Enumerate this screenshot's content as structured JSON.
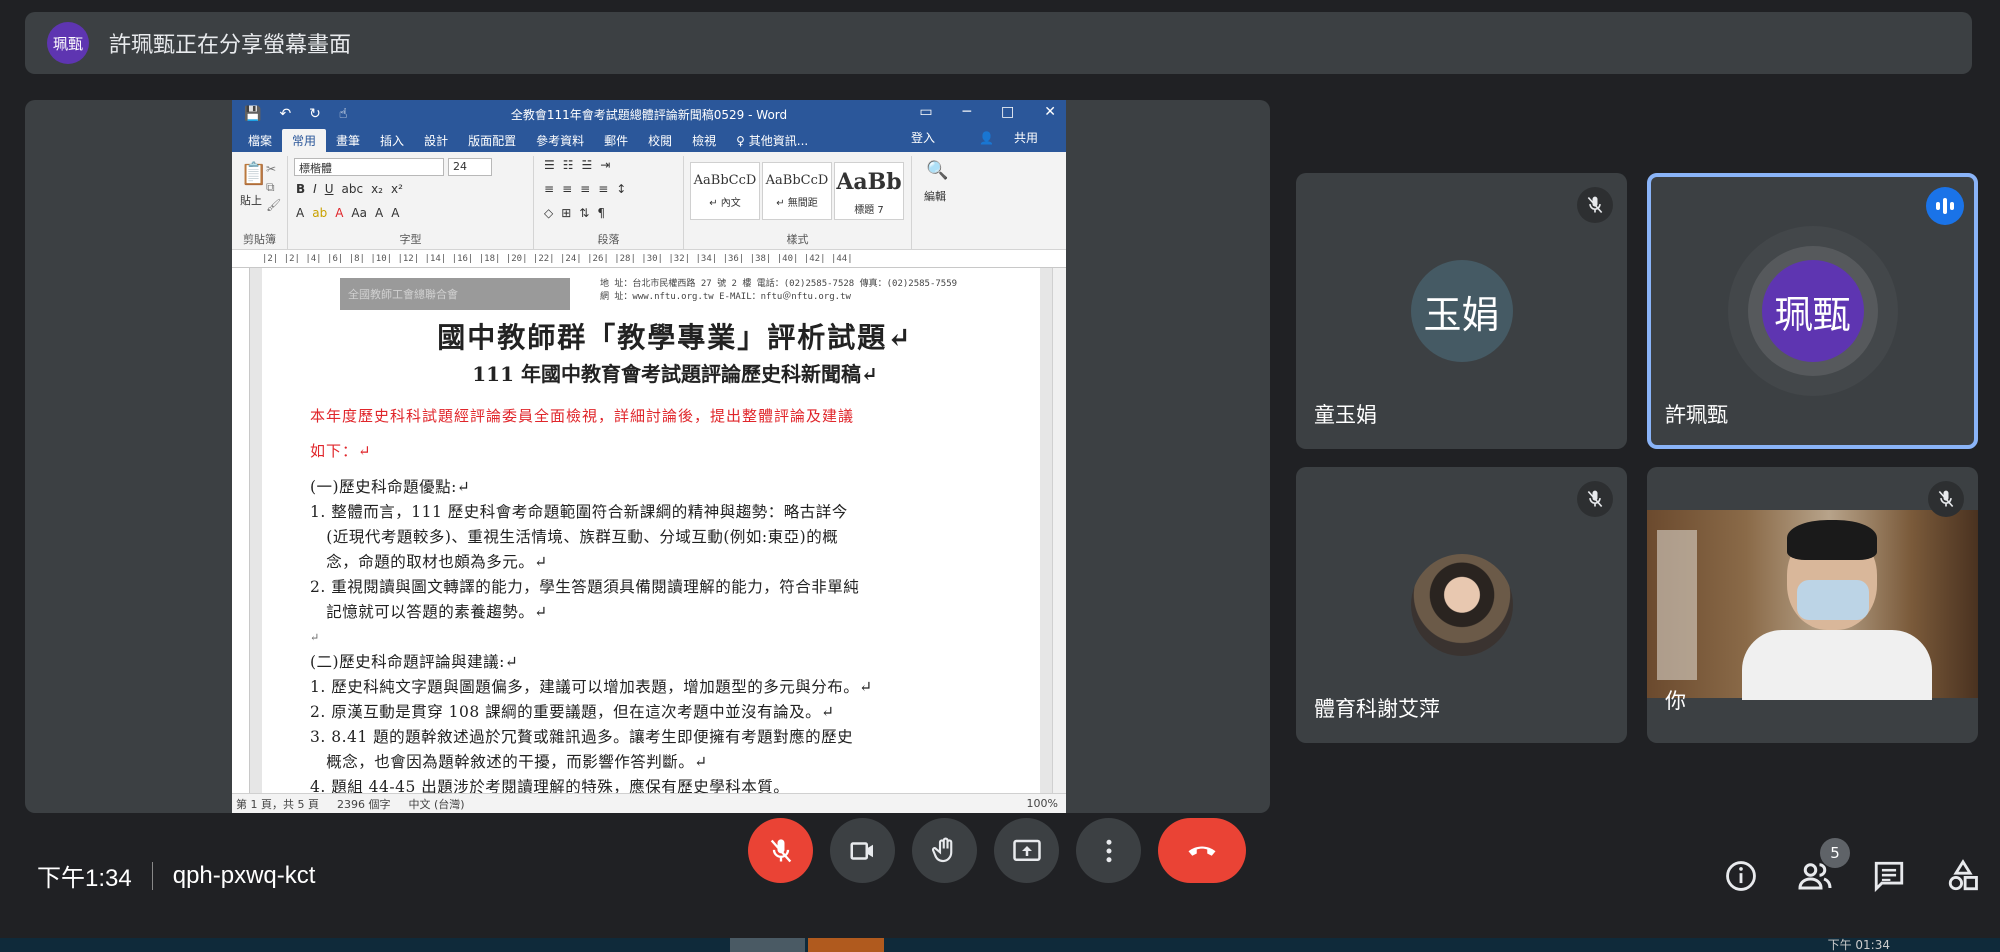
{
  "presenter": {
    "avatar_text": "珮甄",
    "message": "許珮甄正在分享螢幕畫面"
  },
  "word": {
    "doc_title": "全教會111年會考試題總體評論新聞稿0529 - Word",
    "tabs": [
      "檔案",
      "常用",
      "畫筆",
      "插入",
      "設計",
      "版面配置",
      "參考資料",
      "郵件",
      "校閱",
      "檢視",
      "♀ 其他資訊..."
    ],
    "active_tab": "常用",
    "signin": "登入",
    "share": "共用",
    "font_name": "標楷體",
    "font_size": "24",
    "groups": [
      "剪貼簿",
      "字型",
      "段落",
      "樣式",
      "編輯"
    ],
    "paste_label": "貼上",
    "edit_label": "編輯",
    "styles": [
      {
        "sample": "AaBbCcD",
        "name": "↵ 內文"
      },
      {
        "sample": "AaBbCcD",
        "name": "↵ 無間距"
      },
      {
        "sample": "AaBb",
        "name": "標題 7"
      }
    ],
    "ruler": "|2| |2| |4| |6| |8| |10| |12| |14| |16| |18| |20| |22| |24| |26| |28| |30| |32| |34| |36| |38| |40| |42| |44|",
    "logo_text": "全國教師工會總聯合會",
    "address_line1": "地  址：台北市民權西路 27 號 2 樓   電話：(02)2585-7528   傳真：(02)2585-7559",
    "address_line2": "網  址：www.nftu.org.tw      E-MAIL：nftu＠nftu.org.tw",
    "heading1": "國中教師群「教學專業」評析試題↵",
    "heading2": "111 年國中教育會考試題評論歷史科新聞稿↵",
    "red_line1": "本年度歷史科科試題經評論委員全面檢視，詳細討論後，提出整體評論及建議",
    "red_line2": "如下：↵",
    "sec1_title": "(一)歷史科命題優點:↵",
    "sec1_lines": [
      "1. 整體而言，111 歷史科會考命題範圍符合新課綱的精神與趨勢：略古詳今",
      "   (近現代考題較多)、重視生活情境、族群互動、分域互動(例如:東亞)的概",
      "   念，命題的取材也頗為多元。↵",
      "2. 重視閱讀與圖文轉譯的能力，學生答題須具備閱讀理解的能力，符合非單純",
      "   記憶就可以答題的素養趨勢。↵"
    ],
    "blank": "↵",
    "sec2_title": "(二)歷史科命題評論與建議:↵",
    "sec2_lines": [
      "1. 歷史科純文字題與圖題偏多，建議可以增加表題，增加題型的多元與分布。↵",
      "2. 原漢互動是貫穿 108 課綱的重要議題，但在這次考題中並沒有論及。↵",
      "3. 8.41 題的題幹敘述過於冗贅或雜訊過多。讓考生即便擁有考題對應的歷史",
      "   概念，也會因為題幹敘述的干擾，而影響作答判斷。↵",
      "4. 題組 44-45 出題涉於考閱讀理解的特殊，應保有歷史學科本質。"
    ],
    "status": [
      "第 1 頁，共 5 頁",
      "2396 個字",
      "中文 (台灣)"
    ],
    "zoom": "100%"
  },
  "participants": [
    {
      "name": "童玉娟",
      "initials": "玉娟",
      "color": "#455a64",
      "muted": true
    },
    {
      "name": "許珮甄",
      "initials": "珮甄",
      "color": "#5e35b1",
      "muted": false,
      "speaking": true
    },
    {
      "name": "體育科謝艾萍",
      "muted": true,
      "photo": true
    },
    {
      "name": "你",
      "muted": true,
      "video": true
    }
  ],
  "meeting": {
    "time": "下午1:34",
    "code": "qph-pxwq-kct",
    "participant_count": "5"
  },
  "taskbar_clock": "下午 01:34",
  "colors": {
    "background": "#202124",
    "tile": "#3c4043",
    "accent_red": "#ea4335",
    "word_blue": "#2b579a",
    "speaking_blue": "#8ab4f8"
  }
}
